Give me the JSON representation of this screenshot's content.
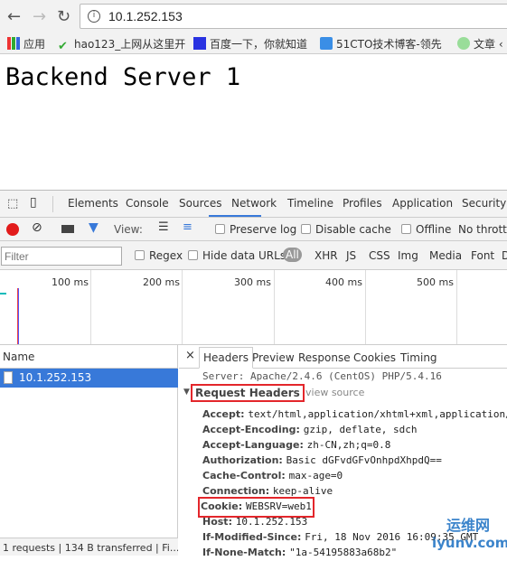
{
  "browser": {
    "url": "10.1.252.153",
    "bookmarks": [
      {
        "label": "应用"
      },
      {
        "label": "hao123_上网从这里开"
      },
      {
        "label": "百度一下，你就知道"
      },
      {
        "label": "51CTO技术博客-领先"
      },
      {
        "label": "文章 ‹"
      }
    ]
  },
  "page": {
    "title": "Backend Server 1"
  },
  "devtools": {
    "tabs": [
      "Elements",
      "Console",
      "Sources",
      "Network",
      "Timeline",
      "Profiles",
      "Application",
      "Security"
    ],
    "active_tab": "Network",
    "toolbar": {
      "view_label": "View:",
      "preserve_log": "Preserve log",
      "disable_cache": "Disable cache",
      "offline": "Offline",
      "throttling": "No throttlin"
    },
    "filter": {
      "placeholder": "Filter",
      "regex": "Regex",
      "hide_data_urls": "Hide data URLs",
      "types": [
        "All",
        "XHR",
        "JS",
        "CSS",
        "Img",
        "Media",
        "Font",
        "D"
      ]
    },
    "timeline_ticks": [
      "100 ms",
      "200 ms",
      "300 ms",
      "400 ms",
      "500 ms"
    ],
    "requests": {
      "header": "Name",
      "items": [
        "10.1.252.153"
      ],
      "status": "1 requests | 134 B transferred | Fi..."
    },
    "detail": {
      "tabs": [
        "Headers",
        "Preview",
        "Response",
        "Cookies",
        "Timing"
      ],
      "cut_line": "Server: Apache/2.4.6 (CentOS) PHP/5.4.16",
      "section": "Request Headers",
      "view_source": "view source",
      "headers": [
        {
          "k": "Accept:",
          "v": "text/html,application/xhtml+xml,application/"
        },
        {
          "k": "Accept-Encoding:",
          "v": "gzip, deflate, sdch"
        },
        {
          "k": "Accept-Language:",
          "v": "zh-CN,zh;q=0.8"
        },
        {
          "k": "Authorization:",
          "v": "Basic dGFvdGFvOnhpdXhpdQ=="
        },
        {
          "k": "Cache-Control:",
          "v": "max-age=0"
        },
        {
          "k": "Connection:",
          "v": "keep-alive"
        },
        {
          "k": "Cookie:",
          "v": "WEBSRV=web1"
        },
        {
          "k": "Host:",
          "v": "10.1.252.153"
        },
        {
          "k": "If-Modified-Since:",
          "v": "Fri, 18 Nov 2016 16:09:35 GMT"
        },
        {
          "k": "If-None-Match:",
          "v": "\"1a-54195883a68b2\""
        }
      ]
    }
  },
  "watermark": {
    "cn": "运维网",
    "en": "iyunv.com"
  },
  "colors": {
    "highlight": "#e3262b",
    "selected": "#3879d9",
    "record": "#e21b1b"
  }
}
